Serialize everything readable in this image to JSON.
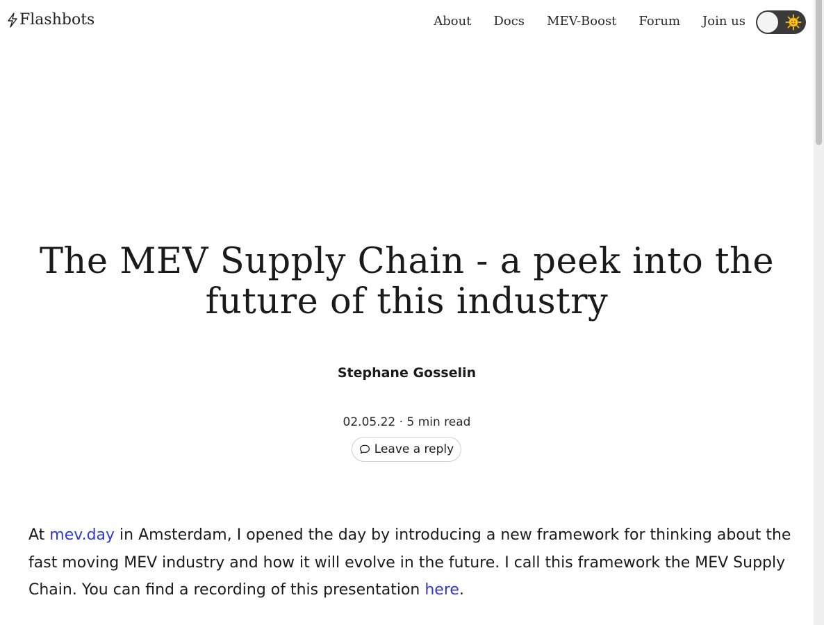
{
  "header": {
    "brand": "Flashbots",
    "nav": [
      {
        "label": "About"
      },
      {
        "label": "Docs"
      },
      {
        "label": "MEV-Boost"
      },
      {
        "label": "Forum"
      },
      {
        "label": "Join us"
      }
    ],
    "theme_toggle": {
      "state": "light",
      "icon": "sun-icon"
    }
  },
  "post": {
    "title": "The MEV Supply Chain - a peek into the future of this industry",
    "author": "Stephane Gosselin",
    "date": "02.05.22",
    "separator": "·",
    "read_time": "5 min read",
    "reply_label": "Leave a reply"
  },
  "body": {
    "p1_before": "At ",
    "p1_link1": "mev.day",
    "p1_middle": " in Amsterdam, I opened the day by introducing a new framework for thinking about the fast moving MEV industry and how it will evolve in the future. I call this framework the MEV Supply Chain. You can find a recording of this presentation ",
    "p1_link2": "here",
    "p1_after": "."
  },
  "colors": {
    "link": "#2e3ad6",
    "toggle_track": "#3a3a3a",
    "sun": "#f5b400"
  }
}
